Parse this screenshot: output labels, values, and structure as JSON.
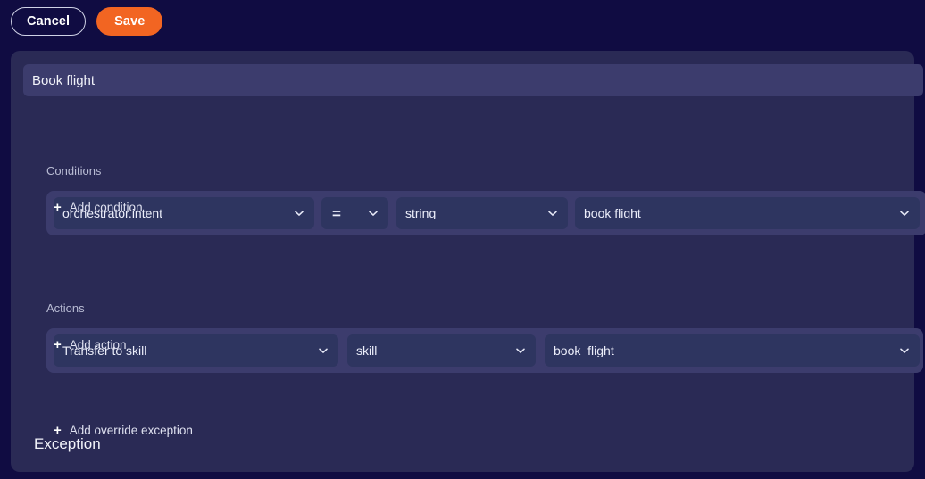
{
  "toolbar": {
    "cancel_label": "Cancel",
    "save_label": "Save",
    "save_color": "#f26522"
  },
  "card": {
    "title": "Book flight",
    "conditions": {
      "label": "Conditions",
      "rows": [
        {
          "field": "orchestrator.intent",
          "operator": "=",
          "type": "string",
          "value": "book flight"
        }
      ],
      "add_label": "Add condition"
    },
    "actions": {
      "label": "Actions",
      "rows": [
        {
          "action_type": "Transfer to skill",
          "param": "skill",
          "value": "book_flight"
        }
      ],
      "add_label": "Add action"
    },
    "exception": {
      "heading": "Exception",
      "add_label": "Add override exception"
    }
  },
  "icons": {
    "chevron_down": "chevron-down-icon",
    "plus": "+"
  },
  "colors": {
    "page_background": "#100c42",
    "card_background": "#2a2a55",
    "row_background": "#3c3c6d",
    "select_background": "#2e3560",
    "accent": "#f26522"
  }
}
